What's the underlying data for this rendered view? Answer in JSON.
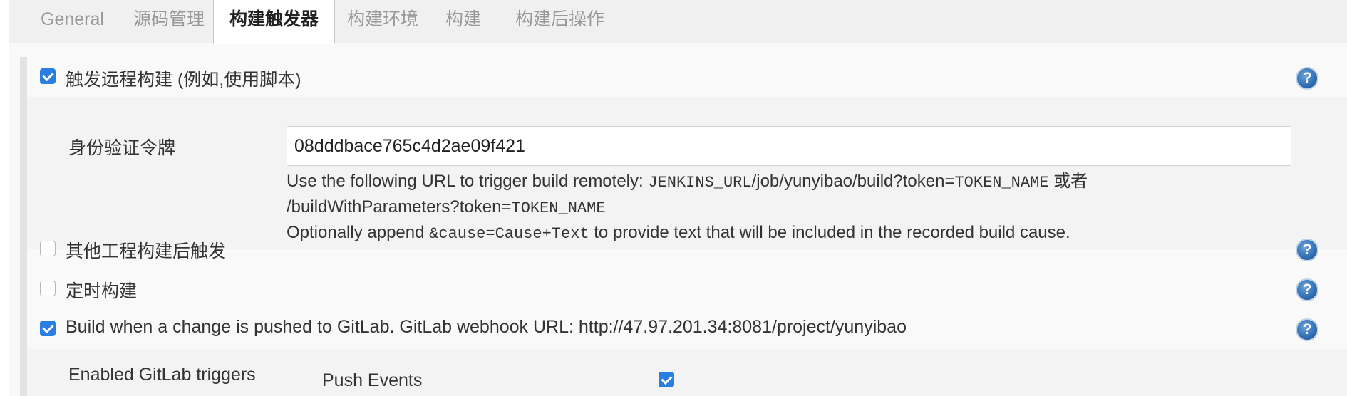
{
  "tabs": [
    {
      "label": "General",
      "active": false
    },
    {
      "label": "源码管理",
      "active": false
    },
    {
      "label": "构建触发器",
      "active": true
    },
    {
      "label": "构建环境",
      "active": false
    },
    {
      "label": "构建",
      "active": false
    },
    {
      "label": "构建后操作",
      "active": false
    }
  ],
  "triggers": {
    "remote": {
      "label": "触发远程构建 (例如,使用脚本)",
      "checked": true
    },
    "token_label": "身份验证令牌",
    "token_value": "08dddbace765c4d2ae09f421",
    "help_line1_prefix": "Use the following URL to trigger build remotely: ",
    "help_line1_var": "JENKINS_URL",
    "help_line1_mid": "/job/yunyibao/build?token=",
    "help_line1_token": "TOKEN_NAME",
    "help_line1_suffix": " 或者",
    "help_line2_prefix": "/buildWithParameters?token=",
    "help_line2_token": "TOKEN_NAME",
    "help_line3_prefix": "Optionally append ",
    "help_line3_code": "&cause=Cause+Text",
    "help_line3_suffix": " to provide text that will be included in the recorded build cause.",
    "after_other": {
      "label": "其他工程构建后触发",
      "checked": false
    },
    "periodic": {
      "label": "定时构建",
      "checked": false
    },
    "gitlab": {
      "label": "Build when a change is pushed to GitLab. GitLab webhook URL: http://47.97.201.34:8081/project/yunyibao",
      "checked": true
    },
    "gitlab_triggers_label": "Enabled GitLab triggers",
    "push_events": {
      "label": "Push Events",
      "checked": true
    }
  },
  "help_glyph": "?",
  "colors": {
    "accent": "#2a7de1",
    "help_blue": "#2f6db3"
  }
}
